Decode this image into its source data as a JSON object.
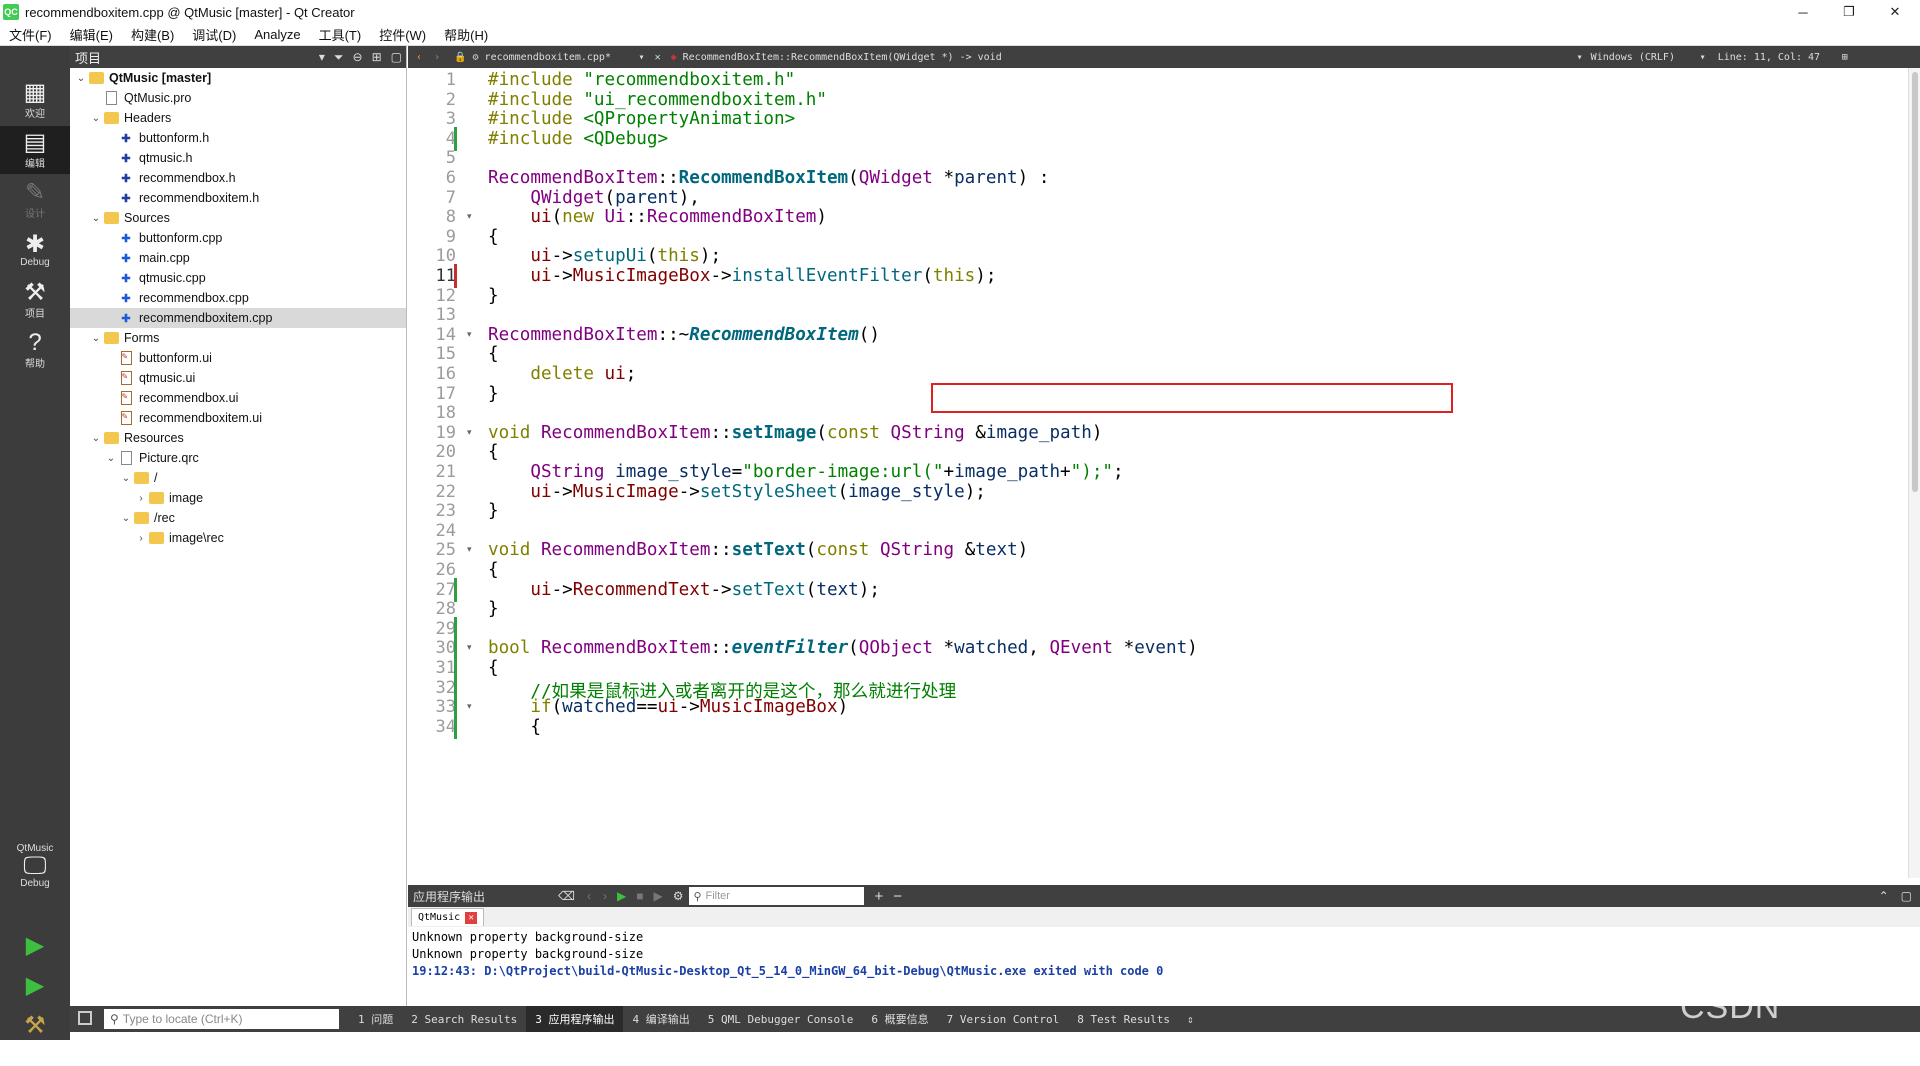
{
  "window": {
    "title": "recommendboxitem.cpp @ QtMusic [master] - Qt Creator",
    "app_icon": "QC",
    "minimize": "─",
    "restore": "❐",
    "close": "✕"
  },
  "menu": [
    "文件(F)",
    "编辑(E)",
    "构建(B)",
    "调试(D)",
    "Analyze",
    "工具(T)",
    "控件(W)",
    "帮助(H)"
  ],
  "modes": [
    {
      "label": "欢迎",
      "icon": "grid-icon"
    },
    {
      "label": "编辑",
      "icon": "edit-icon"
    },
    {
      "label": "设计",
      "icon": "pencil-icon"
    },
    {
      "label": "Debug",
      "icon": "bug-icon"
    },
    {
      "label": "项目",
      "icon": "wrench-icon"
    },
    {
      "label": "帮助",
      "icon": "help-icon"
    }
  ],
  "kit": {
    "project": "QtMusic",
    "config": "Debug"
  },
  "project_panel": {
    "title": "项目",
    "tree": [
      {
        "label": "QtMusic [master]",
        "depth": 0,
        "type": "project",
        "expanded": true,
        "bold": true
      },
      {
        "label": "QtMusic.pro",
        "depth": 1,
        "type": "pro"
      },
      {
        "label": "Headers",
        "depth": 1,
        "type": "folder",
        "expanded": true
      },
      {
        "label": "buttonform.h",
        "depth": 2,
        "type": "h"
      },
      {
        "label": "qtmusic.h",
        "depth": 2,
        "type": "h"
      },
      {
        "label": "recommendbox.h",
        "depth": 2,
        "type": "h"
      },
      {
        "label": "recommendboxitem.h",
        "depth": 2,
        "type": "h"
      },
      {
        "label": "Sources",
        "depth": 1,
        "type": "folder",
        "expanded": true
      },
      {
        "label": "buttonform.cpp",
        "depth": 2,
        "type": "cpp"
      },
      {
        "label": "main.cpp",
        "depth": 2,
        "type": "cpp"
      },
      {
        "label": "qtmusic.cpp",
        "depth": 2,
        "type": "cpp"
      },
      {
        "label": "recommendbox.cpp",
        "depth": 2,
        "type": "cpp"
      },
      {
        "label": "recommendboxitem.cpp",
        "depth": 2,
        "type": "cpp",
        "selected": true
      },
      {
        "label": "Forms",
        "depth": 1,
        "type": "folder",
        "expanded": true
      },
      {
        "label": "buttonform.ui",
        "depth": 2,
        "type": "ui"
      },
      {
        "label": "qtmusic.ui",
        "depth": 2,
        "type": "ui"
      },
      {
        "label": "recommendbox.ui",
        "depth": 2,
        "type": "ui"
      },
      {
        "label": "recommendboxitem.ui",
        "depth": 2,
        "type": "ui"
      },
      {
        "label": "Resources",
        "depth": 1,
        "type": "folder",
        "expanded": true
      },
      {
        "label": "Picture.qrc",
        "depth": 2,
        "type": "pro",
        "expanded": true
      },
      {
        "label": "/",
        "depth": 3,
        "type": "folder",
        "expanded": true
      },
      {
        "label": "image",
        "depth": 4,
        "type": "folder",
        "expanded": false
      },
      {
        "label": "/rec",
        "depth": 3,
        "type": "folder",
        "expanded": true
      },
      {
        "label": "image\\rec",
        "depth": 4,
        "type": "folder",
        "expanded": false
      }
    ]
  },
  "editor_bar": {
    "file_tab": "recommendboxitem.cpp*",
    "symbol": "RecommendBoxItem::RecommendBoxItem(QWidget *) -> void",
    "line_ending": "Windows (CRLF)",
    "position": "Line: 11, Col: 47"
  },
  "code_lines": [
    {
      "n": "1",
      "html": "<span class=\"kw\">#include</span> <span class=\"str\">\"recommendboxitem.h\"</span>"
    },
    {
      "n": "2",
      "html": "<span class=\"kw\">#include</span> <span class=\"str\">\"ui_recommendboxitem.h\"</span>"
    },
    {
      "n": "3",
      "html": "<span class=\"kw\">#include</span> <span class=\"str\">&lt;QPropertyAnimation&gt;</span>"
    },
    {
      "n": "4",
      "html": "<span class=\"kw\">#include</span> <span class=\"str\">&lt;QDebug&gt;</span>",
      "changed": true
    },
    {
      "n": "5",
      "html": ""
    },
    {
      "n": "6",
      "html": "<span class=\"cls\">RecommendBoxItem</span>::<span class=\"fnb\">RecommendBoxItem</span>(<span class=\"cls\">QWidget</span> *<span class=\"hl\">parent</span>) :"
    },
    {
      "n": "7",
      "html": "    <span class=\"cls\">QWidget</span>(<span class=\"hl\">parent</span>),"
    },
    {
      "n": "8",
      "html": "    <span class=\"mem\">ui</span>(<span class=\"kw\">new</span> <span class=\"cls\">Ui</span>::<span class=\"cls\">RecommendBoxItem</span>)",
      "fold": true
    },
    {
      "n": "9",
      "html": "{"
    },
    {
      "n": "10",
      "html": "    <span class=\"mem\">ui</span>-&gt;<span class=\"fn\">setupUi</span>(<span class=\"kw\">this</span>);"
    },
    {
      "n": "11",
      "html": "    <span class=\"mem\">ui</span>-&gt;<span class=\"mem\">MusicImageBox</span>-&gt;<span class=\"fn\">installEventFilter</span>(<span class=\"kw\">this</span>);",
      "current": true,
      "changed": true
    },
    {
      "n": "12",
      "html": "}"
    },
    {
      "n": "13",
      "html": ""
    },
    {
      "n": "14",
      "html": "<span class=\"cls\">RecommendBoxItem</span>::~<span class=\"fni\">RecommendBoxItem</span>()",
      "fold": true
    },
    {
      "n": "15",
      "html": "{"
    },
    {
      "n": "16",
      "html": "    <span class=\"kw\">delete</span> <span class=\"mem\">ui</span>;"
    },
    {
      "n": "17",
      "html": "}"
    },
    {
      "n": "18",
      "html": ""
    },
    {
      "n": "19",
      "html": "<span class=\"kw\">void</span> <span class=\"cls\">RecommendBoxItem</span>::<span class=\"fnb\">setImage</span>(<span class=\"kw\">const</span> <span class=\"cls\">QString</span> &amp;<span class=\"hl\">image_path</span>)",
      "fold": true
    },
    {
      "n": "20",
      "html": "{"
    },
    {
      "n": "21",
      "html": "    <span class=\"cls\">QString</span> <span class=\"hl\">image_style</span>=<span class=\"str\">\"border-image:url(\"</span>+<span class=\"hl\">image_path</span>+<span class=\"str\">\");\"</span>;"
    },
    {
      "n": "22",
      "html": "    <span class=\"mem\">ui</span>-&gt;<span class=\"mem\">MusicImage</span>-&gt;<span class=\"fn\">setStyleSheet</span>(<span class=\"hl\">image_style</span>);"
    },
    {
      "n": "23",
      "html": "}"
    },
    {
      "n": "24",
      "html": ""
    },
    {
      "n": "25",
      "html": "<span class=\"kw\">void</span> <span class=\"cls\">RecommendBoxItem</span>::<span class=\"fnb\">setText</span>(<span class=\"kw\">const</span> <span class=\"cls\">QString</span> &amp;<span class=\"hl\">text</span>)",
      "fold": true
    },
    {
      "n": "26",
      "html": "{"
    },
    {
      "n": "27",
      "html": "    <span class=\"mem\">ui</span>-&gt;<span class=\"mem\">RecommendText</span>-&gt;<span class=\"fn\">setText</span>(<span class=\"hl\">text</span>);",
      "changed": true
    },
    {
      "n": "28",
      "html": "}"
    },
    {
      "n": "29",
      "html": "",
      "changed": true
    },
    {
      "n": "30",
      "html": "<span class=\"kw\">bool</span> <span class=\"cls\">RecommendBoxItem</span>::<span class=\"fni\">eventFilter</span>(<span class=\"cls\">QObject</span> *<span class=\"hl\">watched</span>, <span class=\"cls\">QEvent</span> *<span class=\"hl\">event</span>)",
      "fold": true,
      "changed": true
    },
    {
      "n": "31",
      "html": "{",
      "changed": true
    },
    {
      "n": "32",
      "html": "    <span class=\"cm\">//如果是鼠标进入或者离开的是这个，那么就进行处理</span>",
      "changed": true
    },
    {
      "n": "33",
      "html": "    <span class=\"kw\">if</span>(<span class=\"hl\">watched</span>==<span class=\"mem\">ui</span>-&gt;<span class=\"mem\">MusicImageBox</span>)",
      "fold": true,
      "changed": true
    },
    {
      "n": "34",
      "html": "    {",
      "changed": true
    }
  ],
  "output_panel": {
    "title": "应用程序输出",
    "filter_placeholder": "Filter",
    "tab": "QtMusic",
    "lines": [
      "Unknown property background-size",
      "Unknown property background-size"
    ],
    "exit_line": "19:12:43: D:\\QtProject\\build-QtMusic-Desktop_Qt_5_14_0_MinGW_64_bit-Debug\\QtMusic.exe exited with code 0"
  },
  "statusbar": {
    "locate_placeholder": "Type to locate (Ctrl+K)",
    "tabs": [
      "1 问题",
      "2 Search Results",
      "3 应用程序输出",
      "4 编译输出",
      "5 QML Debugger Console",
      "6 概要信息",
      "7 Version Control",
      "8 Test Results"
    ],
    "active_tab": 2
  },
  "watermark": "CSDN @YMiKi"
}
